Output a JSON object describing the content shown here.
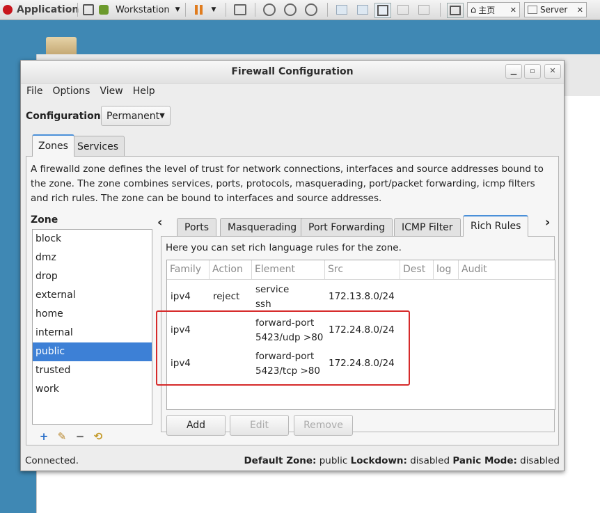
{
  "host": {
    "app_label": "Application",
    "vm_menu": "Workstation",
    "tabs": [
      "主页",
      "Server"
    ]
  },
  "window": {
    "title": "Firewall Configuration"
  },
  "menu": [
    "File",
    "Options",
    "View",
    "Help"
  ],
  "configuration": {
    "label": "Configuration:",
    "value": "Permanent"
  },
  "main_tabs": [
    "Zones",
    "Services"
  ],
  "zone_description": "A firewalld zone defines the level of trust for network connections, interfaces and source addresses bound to the zone. The zone combines services, ports, protocols, masquerading, port/packet forwarding, icmp filters and rich rules. The zone can be bound to interfaces and source addresses.",
  "zone_header": "Zone",
  "zones": [
    "block",
    "dmz",
    "drop",
    "external",
    "home",
    "internal",
    "public",
    "trusted",
    "work"
  ],
  "selected_zone": "public",
  "sub_tabs": [
    "Ports",
    "Masquerading",
    "Port Forwarding",
    "ICMP Filter",
    "Rich Rules"
  ],
  "rich_rules": {
    "description": "Here you can set rich language rules for the zone.",
    "columns": [
      "Family",
      "Action",
      "Element",
      "Src",
      "Dest",
      "log",
      "Audit"
    ],
    "rows": [
      {
        "family": "ipv4",
        "action": "reject",
        "element_1": "service",
        "element_2": "ssh",
        "src": "172.13.8.0/24"
      },
      {
        "family": "ipv4",
        "action": "",
        "element_1": "forward-port",
        "element_2": "5423/udp >80",
        "src": "172.24.8.0/24"
      },
      {
        "family": "ipv4",
        "action": "",
        "element_1": "forward-port",
        "element_2": "5423/tcp >80",
        "src": "172.24.8.0/24"
      }
    ],
    "buttons": {
      "add": "Add",
      "edit": "Edit",
      "remove": "Remove"
    }
  },
  "status": {
    "left": "Connected.",
    "default_zone_label": "Default Zone:",
    "default_zone": "public",
    "lockdown_label": "Lockdown:",
    "lockdown": "disabled",
    "panic_label": "Panic Mode:",
    "panic": "disabled"
  },
  "colors": {
    "selection": "#3d80d6",
    "highlight_box": "#d62a2a",
    "tab_accent": "#4a90d9"
  }
}
